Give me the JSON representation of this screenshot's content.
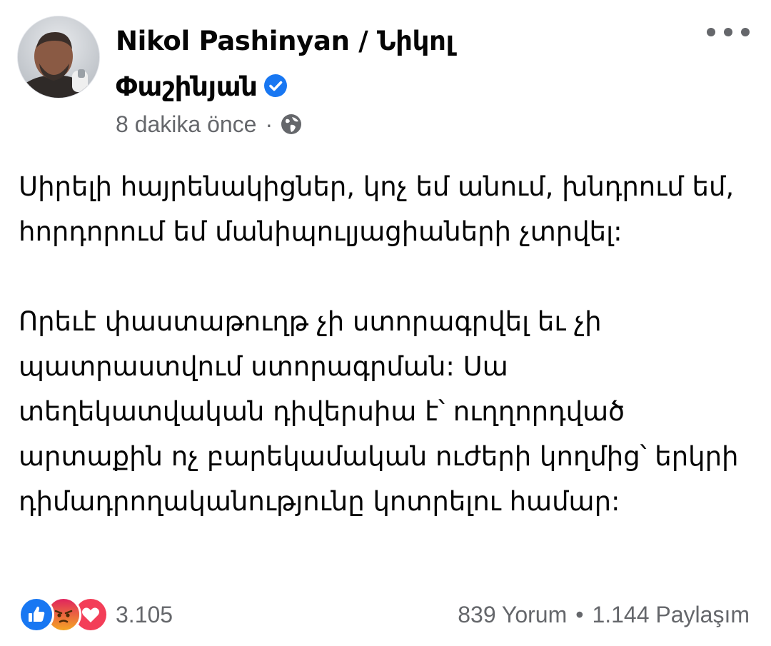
{
  "post": {
    "author_name": "Nikol Pashinyan / Նիկոլ Փաշինյան",
    "timestamp": "8 dakika önce",
    "meta_separator": "·",
    "privacy_icon": "globe-icon",
    "verified_icon": "verified-badge-icon",
    "paragraphs": [
      "Սիրելի հայրենակիցներ, կոչ եմ անում, խնդրում եմ, հորդորում եմ մանիպուլյացիաների չտրվել:",
      "Որեւէ փաստաթուղթ չի ստորագրվել եւ չի պատրաստվում ստորագրման: Սա տեղեկատվական դիվերսիա է՝ ուղղորդված արտաքին ոչ բարեկամական ուժերի կողմից՝ երկրի դիմադրողականությունը կոտրելու համար:"
    ]
  },
  "reactions": {
    "icons": [
      "like-icon",
      "angry-icon",
      "love-icon"
    ],
    "count": "3.105"
  },
  "stats": {
    "comments": "839 Yorum",
    "separator": "•",
    "shares": "1.144 Paylaşım"
  },
  "colors": {
    "text": "#050505",
    "secondary": "#65676b",
    "verified_blue": "#1877f2",
    "like_blue": "#1877f2",
    "love_red": "#f33e58",
    "angry_orange": "#e9710f"
  }
}
